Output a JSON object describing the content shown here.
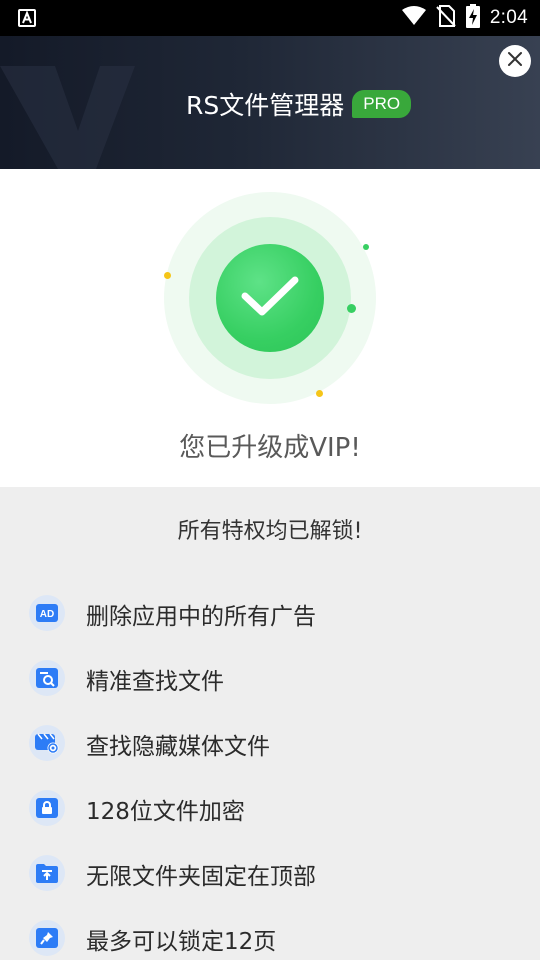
{
  "status_bar": {
    "time": "2:04",
    "icons": [
      "notification-a-icon",
      "wifi-icon",
      "no-sim-icon",
      "battery-charging-icon"
    ]
  },
  "header": {
    "title": "RS文件管理器",
    "badge": "PRO",
    "close_icon": "close-icon"
  },
  "success": {
    "message": "您已升级成VIP!",
    "icon": "checkmark-icon"
  },
  "features": {
    "title": "所有特权均已解锁!",
    "items": [
      {
        "label": "删除应用中的所有广告",
        "icon": "ad-block-icon"
      },
      {
        "label": "精准查找文件",
        "icon": "file-search-icon"
      },
      {
        "label": "查找隐藏媒体文件",
        "icon": "hidden-media-icon"
      },
      {
        "label": "128位文件加密",
        "icon": "lock-icon"
      },
      {
        "label": "无限文件夹固定在顶部",
        "icon": "folder-pin-top-icon"
      },
      {
        "label": "最多可以锁定12页",
        "icon": "pin-icon"
      }
    ]
  },
  "colors": {
    "accent_green": "#37cf62",
    "badge_green": "#39a83b",
    "feature_icon_blue": "#2d7cf6",
    "header_dark": "#1f2736"
  }
}
